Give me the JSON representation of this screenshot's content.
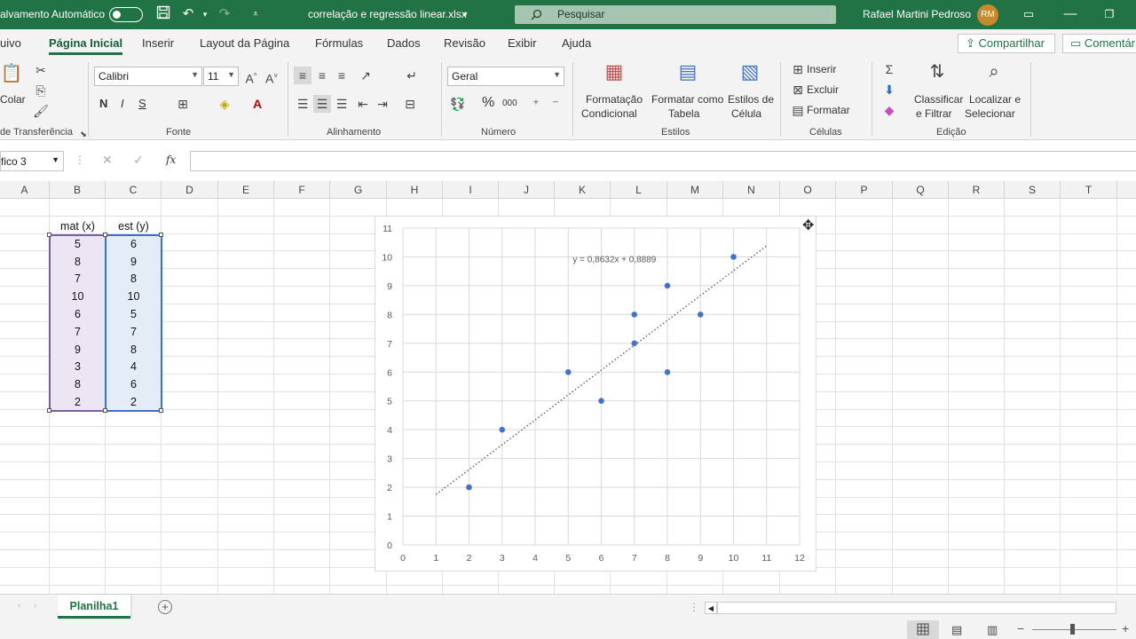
{
  "titlebar": {
    "autosave_label": "alvamento Automático",
    "filename": "correlação e regressão linear.xlsx",
    "search_placeholder": "Pesquisar",
    "user_name": "Rafael Martini Pedroso",
    "user_initials": "RM"
  },
  "menu": {
    "tabs": [
      "uivo",
      "Página Inicial",
      "Inserir",
      "Layout da Página",
      "Fórmulas",
      "Dados",
      "Revisão",
      "Exibir",
      "Ajuda"
    ],
    "share_label": "Compartilhar",
    "comments_label": "Comentár"
  },
  "ribbon": {
    "clipboard": {
      "paste_label": "Colar",
      "group_label": "de Transferência"
    },
    "font": {
      "name": "Calibri",
      "size": "11",
      "bold": "N",
      "italic": "I",
      "underline": "S",
      "group_label": "Fonte"
    },
    "alignment": {
      "group_label": "Alinhamento"
    },
    "number": {
      "format": "Geral",
      "percent": "%",
      "thousands": "000",
      "group_label": "Número"
    },
    "styles": {
      "conditional_label_1": "Formatação",
      "conditional_label_2": "Condicional",
      "table_label_1": "Formatar como",
      "table_label_2": "Tabela",
      "cell_styles_label_1": "Estilos de",
      "cell_styles_label_2": "Célula",
      "group_label": "Estilos"
    },
    "cells": {
      "insert_label": "Inserir",
      "delete_label": "Excluir",
      "format_label": "Formatar",
      "group_label": "Células"
    },
    "editing": {
      "sort_label_1": "Classificar",
      "sort_label_2": "e Filtrar",
      "find_label_1": "Localizar e",
      "find_label_2": "Selecionar",
      "group_label": "Edição"
    }
  },
  "formula_bar": {
    "name_box": "fico 3",
    "fx": "fx",
    "value": ""
  },
  "columns": [
    "A",
    "B",
    "C",
    "D",
    "E",
    "F",
    "G",
    "H",
    "I",
    "J",
    "K",
    "L",
    "M",
    "N",
    "O",
    "P",
    "Q",
    "R",
    "S",
    "T"
  ],
  "table": {
    "headers": [
      "mat (x)",
      "est (y)"
    ],
    "rows": [
      [
        "5",
        "6"
      ],
      [
        "8",
        "9"
      ],
      [
        "7",
        "8"
      ],
      [
        "10",
        "10"
      ],
      [
        "6",
        "5"
      ],
      [
        "7",
        "7"
      ],
      [
        "9",
        "8"
      ],
      [
        "3",
        "4"
      ],
      [
        "8",
        "6"
      ],
      [
        "2",
        "2"
      ]
    ]
  },
  "chart_data": {
    "type": "scatter",
    "points": [
      {
        "x": 5,
        "y": 6
      },
      {
        "x": 8,
        "y": 9
      },
      {
        "x": 7,
        "y": 8
      },
      {
        "x": 10,
        "y": 10
      },
      {
        "x": 6,
        "y": 5
      },
      {
        "x": 7,
        "y": 7
      },
      {
        "x": 9,
        "y": 8
      },
      {
        "x": 3,
        "y": 4
      },
      {
        "x": 8,
        "y": 6
      },
      {
        "x": 2,
        "y": 2
      }
    ],
    "xlim": [
      0,
      12
    ],
    "ylim": [
      0,
      11
    ],
    "xticks": [
      "0",
      "1",
      "2",
      "3",
      "4",
      "5",
      "6",
      "7",
      "8",
      "9",
      "10",
      "11",
      "12"
    ],
    "yticks": [
      "0",
      "1",
      "2",
      "3",
      "4",
      "5",
      "6",
      "7",
      "8",
      "9",
      "10",
      "11"
    ],
    "trendline": {
      "slope": 0.8632,
      "intercept": 0.8889,
      "x_range": [
        1,
        11
      ]
    },
    "equation_label": "y = 0,8632x + 0,8889",
    "grid": true,
    "color": "#4472c4"
  },
  "sheets": {
    "active": "Planilha1"
  }
}
